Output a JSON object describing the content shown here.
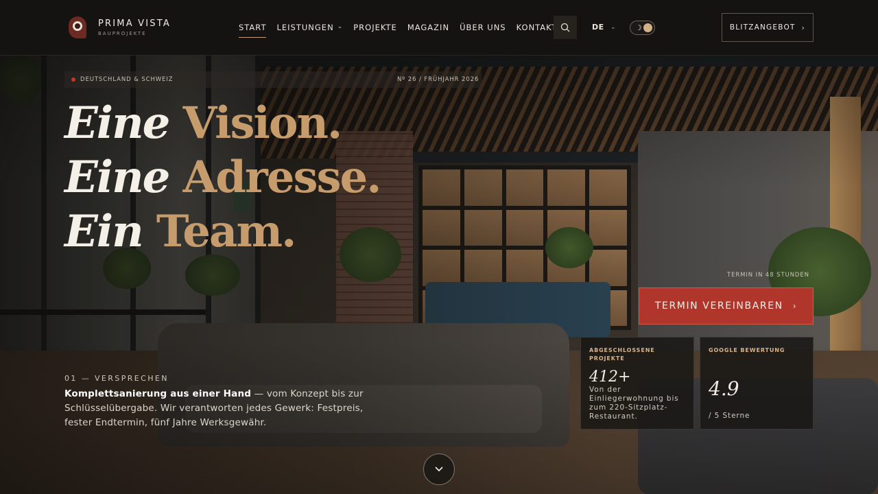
{
  "brand": {
    "name": "PRIMA VISTA",
    "tagline": "BAUPROJEKTE"
  },
  "nav": {
    "items": [
      {
        "label": "START",
        "active": true
      },
      {
        "label": "LEISTUNGEN",
        "dropdown": true
      },
      {
        "label": "PROJEKTE"
      },
      {
        "label": "MAGAZIN"
      },
      {
        "label": "ÜBER UNS"
      },
      {
        "label": "KONTAKT"
      }
    ]
  },
  "header": {
    "search_icon": "search-icon",
    "language": "DE",
    "theme_toggle": {
      "icon": "moon-icon",
      "state": "dark"
    },
    "offer_button": "BLITZANGEBOT",
    "offer_arrow": "›"
  },
  "hero": {
    "region": "DEUTSCHLAND & SCHWEIZ",
    "issue": "Nº 26 / FRÜHJAHR 2026",
    "headline": [
      {
        "lead": "Eine",
        "accent": "Vision."
      },
      {
        "lead": "Eine",
        "accent": "Adresse."
      },
      {
        "lead": "Ein",
        "accent": "Team."
      }
    ],
    "promise_label": "01 — VERSPRECHEN",
    "promise_bold": "Komplettsanierung aus einer Hand",
    "promise_text": " — vom Konzept bis zur Schlüsselübergabe. Wir verantworten jedes Gewerk: Festpreis, fester Endtermin, fünf Jahre Werksgewähr.",
    "deadline_note": "TERMIN IN 48 STUNDEN",
    "cta_label": "TERMIN VEREINBAREN",
    "cta_arrow": "›"
  },
  "stats": [
    {
      "label": "ABGESCHLOSSENE PROJEKTE",
      "value": "412+",
      "desc": "Von der Einliegerwohnung bis zum 220-Sitzplatz-Restaurant."
    },
    {
      "label": "GOOGLE BEWERTUNG",
      "value": "4.9",
      "desc": "/ 5 Sterne"
    }
  ],
  "colors": {
    "accent": "#c69c6d",
    "cta": "#b0352b",
    "brand_red": "#6d2a22",
    "header_bg": "#141312"
  }
}
